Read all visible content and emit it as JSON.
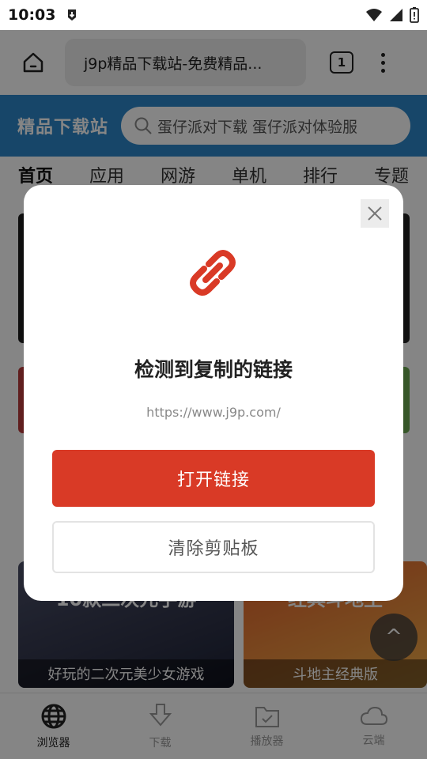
{
  "status_bar": {
    "time": "10:03"
  },
  "toolbar": {
    "url_text": "j9p精品下载站-免费精品...",
    "tab_count": "1"
  },
  "site": {
    "logo": "精品下载站",
    "search_placeholder": "蛋仔派对下载 蛋仔派对体验服",
    "nav": [
      "首页",
      "应用",
      "网游",
      "单机",
      "排行",
      "专题"
    ],
    "cards": [
      {
        "headline": "10款二次元手游",
        "caption": "好玩的二次元美少女游戏"
      },
      {
        "headline": "经典斗地主",
        "caption": "斗地主经典版"
      }
    ],
    "scroll_top_symbol": "^"
  },
  "bottom_nav": [
    {
      "label": "浏览器",
      "icon": "globe-icon"
    },
    {
      "label": "下载",
      "icon": "download-icon"
    },
    {
      "label": "播放器",
      "icon": "player-folder-icon"
    },
    {
      "label": "云端",
      "icon": "cloud-icon"
    }
  ],
  "dialog": {
    "title": "检测到复制的链接",
    "url": "https://www.j9p.com/",
    "open_label": "打开链接",
    "clear_label": "清除剪贴板"
  },
  "colors": {
    "accent": "#d93a26",
    "header_blue": "#2c87c9"
  }
}
